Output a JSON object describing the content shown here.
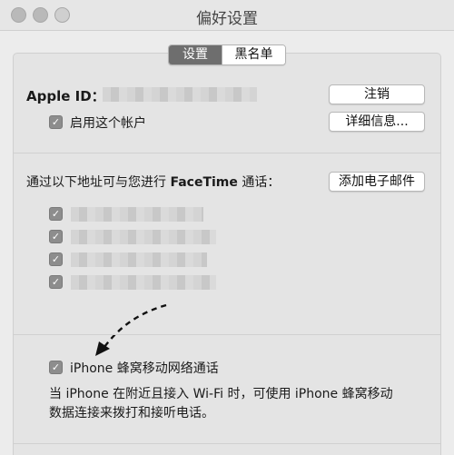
{
  "window": {
    "title": "偏好设置"
  },
  "tabs": [
    {
      "label": "设置",
      "active": true
    },
    {
      "label": "黑名单",
      "active": false
    }
  ],
  "account": {
    "apple_id_label": "Apple ID：",
    "sign_out_button": "注销",
    "enable_account_label": "启用这个帐户",
    "details_button": "详细信息..."
  },
  "facetime": {
    "reach_label_prefix": "通过以下地址可与您进行",
    "reach_label_bold": "FaceTime",
    "reach_label_suffix": "通话：",
    "add_email_button": "添加电子邮件"
  },
  "iphone_calls": {
    "checkbox_label": "iPhone 蜂窝移动网络通话",
    "description_line1": "当 iPhone 在附近且接入 Wi-Fi 时，可使用 iPhone 蜂窝移动",
    "description_line2": "数据连接来拨打和接听电话。"
  }
}
